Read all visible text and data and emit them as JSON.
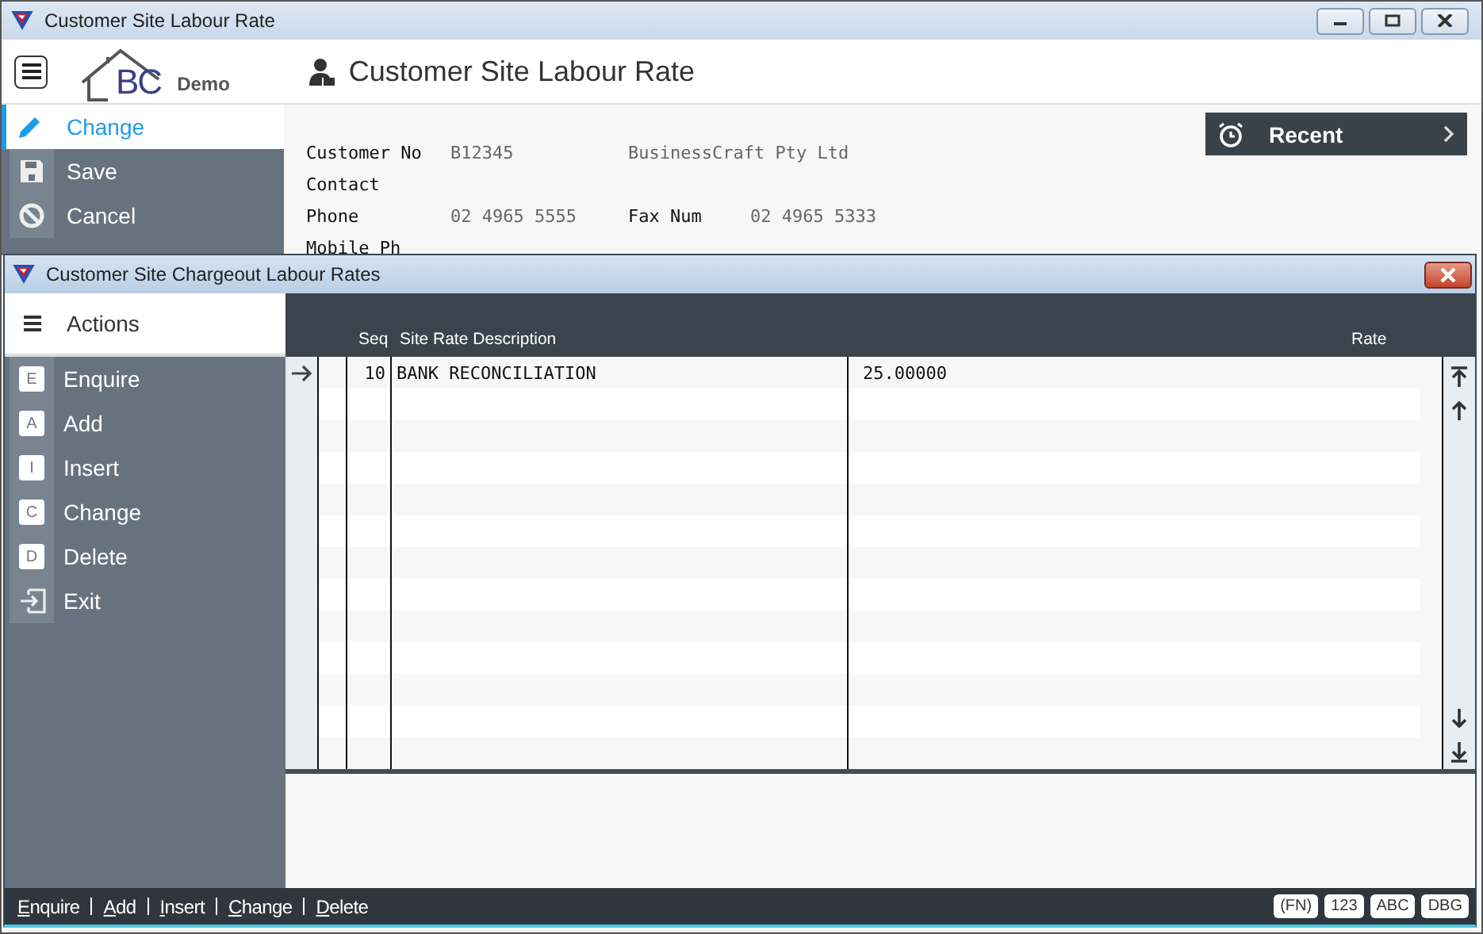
{
  "window": {
    "title": "Customer Site Labour Rate"
  },
  "header": {
    "logo_letters": "BC",
    "logo_suffix": "Demo",
    "title": "Customer Site Labour Rate"
  },
  "sidebar": {
    "items": [
      {
        "label": "Change",
        "selected": true
      },
      {
        "label": "Save",
        "selected": false
      },
      {
        "label": "Cancel",
        "selected": false
      }
    ]
  },
  "fields": [
    {
      "label": "Customer No",
      "value": "B12345",
      "extra": "BusinessCraft Pty Ltd"
    },
    {
      "label": "Contact"
    },
    {
      "label": "Phone",
      "value": "02 4965 5555",
      "extra_label": "Fax Num",
      "extra": "02 4965 5333"
    },
    {
      "label": "Mobile Ph"
    }
  ],
  "recent": {
    "label": "Recent"
  },
  "dialog": {
    "title": "Customer Site Chargeout Labour Rates",
    "actions_title": "Actions",
    "actions": [
      {
        "kind": "key",
        "key": "E",
        "label": "Enquire"
      },
      {
        "kind": "key",
        "key": "A",
        "label": "Add"
      },
      {
        "kind": "key",
        "key": "I",
        "label": "Insert"
      },
      {
        "kind": "key",
        "key": "C",
        "label": "Change"
      },
      {
        "kind": "key",
        "key": "D",
        "label": "Delete"
      },
      {
        "kind": "exit",
        "label": "Exit"
      }
    ],
    "table": {
      "columns": [
        "Seq",
        "Site Rate Description",
        "Rate"
      ],
      "rows": [
        {
          "seq": "10",
          "description": "BANK RECONCILIATION",
          "rate": "25.00000",
          "current": true
        }
      ]
    },
    "status_links": [
      "Enquire",
      "Add",
      "Insert",
      "Change",
      "Delete"
    ],
    "status_badges": [
      "(FN)",
      "123",
      "ABC",
      "DBG"
    ]
  }
}
